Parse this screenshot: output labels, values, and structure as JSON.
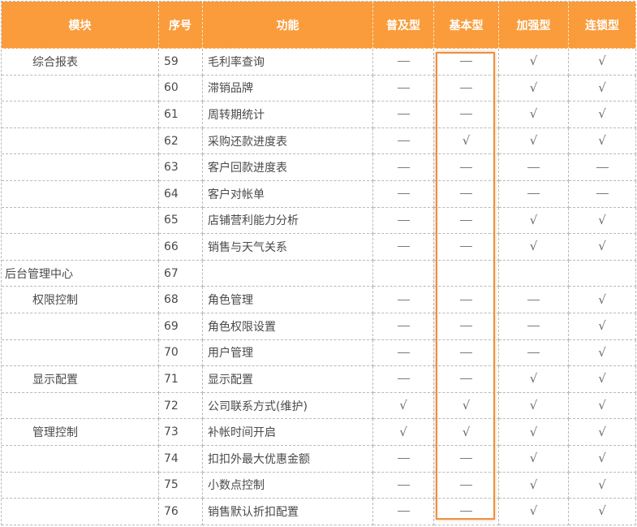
{
  "table": {
    "headers": [
      "模块",
      "序号",
      "功能",
      "普及型",
      "基本型",
      "加强型",
      "连锁型"
    ],
    "rows": [
      {
        "module": "综合报表",
        "indent": 1,
        "no": "59",
        "fn": "毛利率查询",
        "marks": [
          "-",
          "-",
          "v",
          "v"
        ]
      },
      {
        "module": "",
        "indent": 1,
        "no": "60",
        "fn": "滞销品牌",
        "marks": [
          "-",
          "-",
          "v",
          "v"
        ]
      },
      {
        "module": "",
        "indent": 1,
        "no": "61",
        "fn": "周转期统计",
        "marks": [
          "-",
          "-",
          "v",
          "v"
        ]
      },
      {
        "module": "",
        "indent": 1,
        "no": "62",
        "fn": "采购还款进度表",
        "marks": [
          "-",
          "v",
          "v",
          "v"
        ]
      },
      {
        "module": "",
        "indent": 1,
        "no": "63",
        "fn": "客户回款进度表",
        "marks": [
          "-",
          "-",
          "-",
          "-"
        ]
      },
      {
        "module": "",
        "indent": 1,
        "no": "64",
        "fn": "客户对帐单",
        "marks": [
          "-",
          "-",
          "-",
          "-"
        ]
      },
      {
        "module": "",
        "indent": 1,
        "no": "65",
        "fn": "店铺营利能力分析",
        "marks": [
          "-",
          "-",
          "v",
          "v"
        ]
      },
      {
        "module": "",
        "indent": 1,
        "no": "66",
        "fn": "销售与天气关系",
        "marks": [
          "-",
          "-",
          "v",
          "v"
        ]
      },
      {
        "module": "后台管理中心",
        "indent": 0,
        "no": "67",
        "fn": "",
        "marks": [
          "",
          "",
          "",
          ""
        ]
      },
      {
        "module": "权限控制",
        "indent": 1,
        "no": "68",
        "fn": "角色管理",
        "marks": [
          "-",
          "-",
          "-",
          "v"
        ]
      },
      {
        "module": "",
        "indent": 1,
        "no": "69",
        "fn": "角色权限设置",
        "marks": [
          "-",
          "-",
          "-",
          "v"
        ]
      },
      {
        "module": "",
        "indent": 1,
        "no": "70",
        "fn": "用户管理",
        "marks": [
          "-",
          "-",
          "-",
          "v"
        ]
      },
      {
        "module": "显示配置",
        "indent": 1,
        "no": "71",
        "fn": "显示配置",
        "marks": [
          "-",
          "-",
          "v",
          "v"
        ]
      },
      {
        "module": "",
        "indent": 1,
        "no": "72",
        "fn": "公司联系方式(维护)",
        "marks": [
          "v",
          "v",
          "v",
          "v"
        ]
      },
      {
        "module": "管理控制",
        "indent": 1,
        "no": "73",
        "fn": "补帐时间开启",
        "marks": [
          "v",
          "v",
          "v",
          "v"
        ]
      },
      {
        "module": "",
        "indent": 1,
        "no": "74",
        "fn": "扣扣外最大优惠金额",
        "marks": [
          "-",
          "-",
          "v",
          "v"
        ]
      },
      {
        "module": "",
        "indent": 1,
        "no": "75",
        "fn": "小数点控制",
        "marks": [
          "-",
          "-",
          "v",
          "v"
        ]
      },
      {
        "module": "",
        "indent": 1,
        "no": "76",
        "fn": "销售默认折扣配置",
        "marks": [
          "-",
          "-",
          "v",
          "v"
        ]
      }
    ]
  },
  "colors": {
    "header_bg": "#fa9c3b",
    "highlight_border": "#ef8f3e"
  },
  "highlight": {
    "column": "基本型"
  }
}
